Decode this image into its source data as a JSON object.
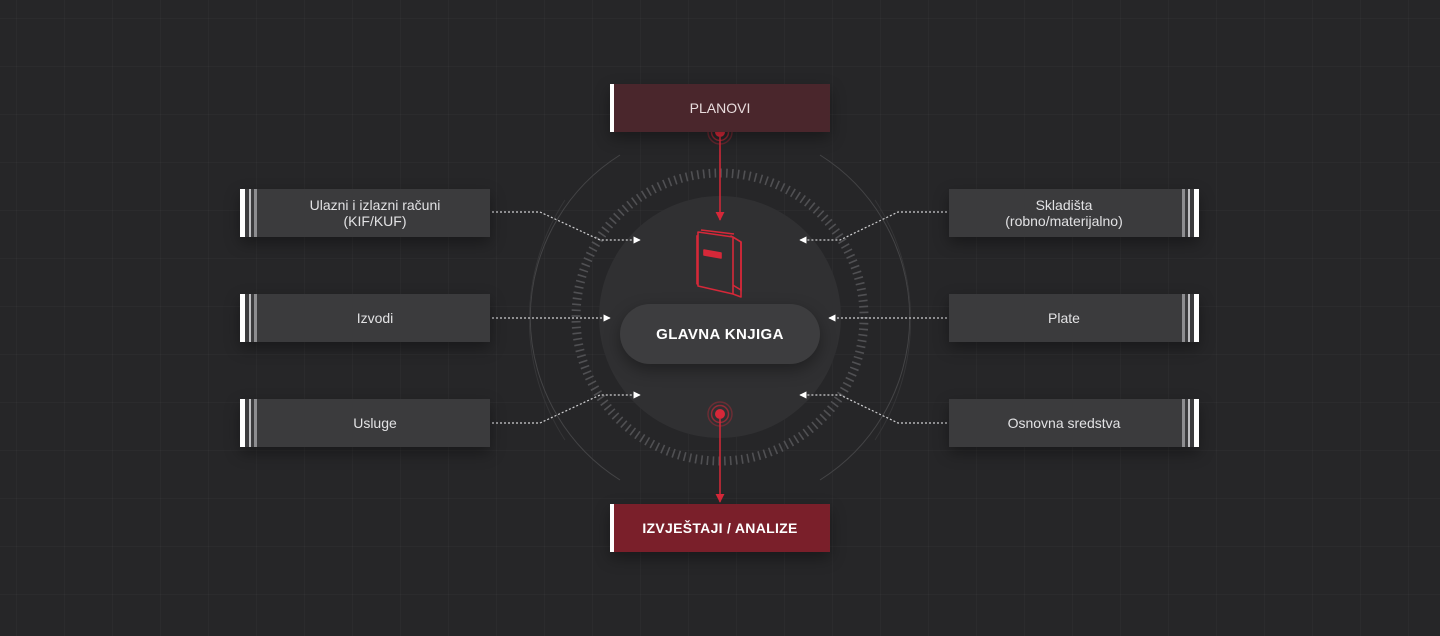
{
  "diagram": {
    "center_label": "GLAVNA KNJIGA",
    "top_box": "PLANOVI",
    "bottom_box": "IZVJEŠTAJI / ANALIZE",
    "left_boxes": [
      {
        "line1": "Ulazni i izlazni računi",
        "line2": "(KIF/KUF)"
      },
      {
        "line1": "Izvodi",
        "line2": ""
      },
      {
        "line1": "Usluge",
        "line2": ""
      }
    ],
    "right_boxes": [
      {
        "line1": "Skladišta",
        "line2": "(robno/materijalno)"
      },
      {
        "line1": "Plate",
        "line2": ""
      },
      {
        "line1": "Osnovna sredstva",
        "line2": ""
      }
    ],
    "center_icon": "book-icon"
  },
  "colors": {
    "background": "#262628",
    "box": "#3b3b3d",
    "accent_red": "#d62839",
    "top_box": "#4a262c",
    "bottom_box": "#7a1f2a"
  }
}
